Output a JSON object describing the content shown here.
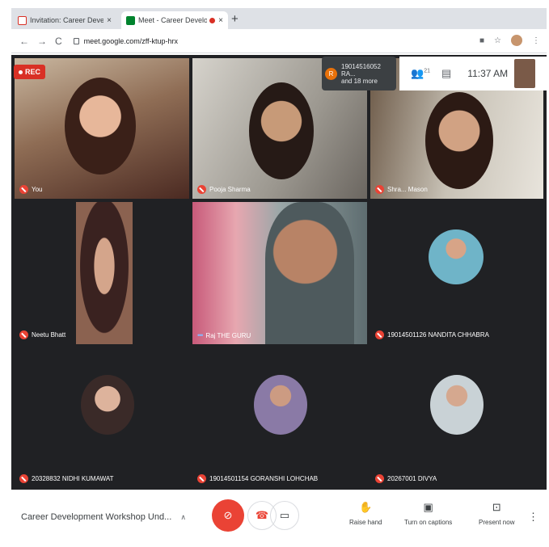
{
  "browser": {
    "tabs": [
      {
        "title": "Invitation: Career Developme",
        "close": "×"
      },
      {
        "title": "Meet - Career Developme",
        "close": "×"
      }
    ],
    "new_tab": "+",
    "url": "meet.google.com/zff-ktup-hrx"
  },
  "meet": {
    "rec_label": "REC",
    "notification": {
      "initial": "R",
      "line1": "19014516052 RA...",
      "line2": "and 18 more"
    },
    "participants_count": "21",
    "time": "11:37 AM",
    "tiles": [
      {
        "name": "You"
      },
      {
        "name": "Pooja Sharma"
      },
      {
        "name": "Shra... Mason"
      },
      {
        "name": "Neetu Bhatt"
      },
      {
        "name": "Raj THE GURU"
      },
      {
        "name": "19014501126 NANDITA CHHABRA"
      },
      {
        "name": "20328832 NIDHI KUMAWAT"
      },
      {
        "name": "19014501154 GORANSHI LOHCHAB"
      },
      {
        "name": "20267001 DIVYA"
      }
    ]
  },
  "bottom": {
    "meeting_title": "Career Development Workshop Und...",
    "raise_hand": "Raise hand",
    "captions": "Turn on captions",
    "present": "Present now"
  },
  "colors": {
    "accent_red": "#ea4335",
    "meet_bg": "#202124"
  }
}
